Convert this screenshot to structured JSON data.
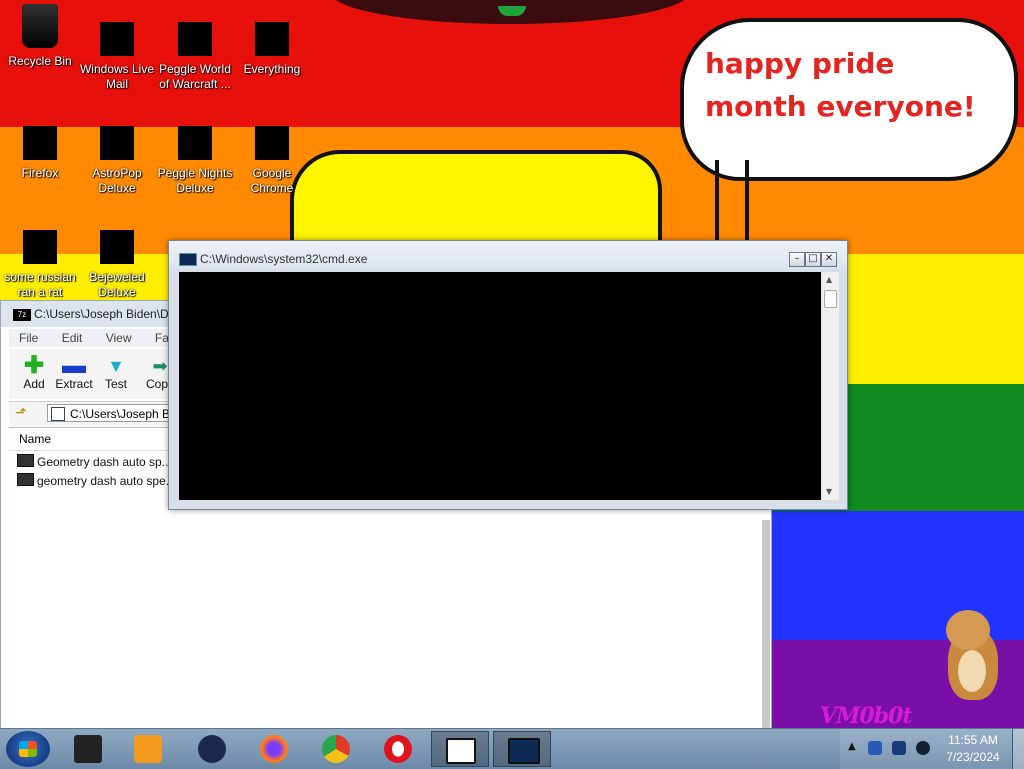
{
  "wallpaper": {
    "speech_text": "happy pride month everyone!",
    "colors": [
      "#e8100b",
      "#ff8a00",
      "#ffee00",
      "#0f8a1f",
      "#2233ff",
      "#7a0fa8"
    ]
  },
  "desktop_icons": [
    {
      "label": "Recycle Bin",
      "icon": "recycle-bin-icon"
    },
    {
      "label": "Windows Live Mail",
      "icon": "mail-icon"
    },
    {
      "label": "Peggle World of Warcraft ...",
      "icon": "peggle-wow-icon"
    },
    {
      "label": "Everything",
      "icon": "everything-search-icon"
    },
    {
      "label": "Firefox",
      "icon": "firefox-icon"
    },
    {
      "label": "AstroPop Deluxe",
      "icon": "astropop-icon"
    },
    {
      "label": "Peggle Nights Deluxe",
      "icon": "peggle-nights-icon"
    },
    {
      "label": "Google Chrome",
      "icon": "chrome-icon"
    },
    {
      "label": "some russian ran a rat",
      "icon": "file-icon"
    },
    {
      "label": "Bejeweled Deluxe",
      "icon": "bejeweled-icon"
    }
  ],
  "zip_window": {
    "title": "C:\\Users\\Joseph Biden\\Do",
    "app_icon": "7z",
    "menu": [
      "File",
      "Edit",
      "View",
      "Favorites"
    ],
    "toolbar": [
      {
        "label": "Add",
        "icon": "plus-icon",
        "color": "#23b023"
      },
      {
        "label": "Extract",
        "icon": "minus-icon",
        "color": "#1a3bc8"
      },
      {
        "label": "Test",
        "icon": "check-icon",
        "color": "#1ab0c8"
      },
      {
        "label": "Copy",
        "icon": "arrow-right-icon",
        "color": "#1a8a6a"
      }
    ],
    "address": "C:\\Users\\Joseph Bi",
    "column_name": "Name",
    "files": [
      "Geometry dash auto sp...",
      "geometry dash auto spe..."
    ]
  },
  "cmd_window": {
    "title": "C:\\Windows\\system32\\cmd.exe",
    "buttons": {
      "minimize": "–",
      "maximize": "□",
      "close": "✕"
    }
  },
  "watermark_text": "VM0b0t",
  "taskbar": {
    "pinned": [
      {
        "name": "taskbar-folder-item",
        "icon": "folder-icon",
        "color": "#222222"
      },
      {
        "name": "taskbar-media-item",
        "icon": "media-player-icon",
        "color": "#f39a1e"
      },
      {
        "name": "taskbar-browser-item",
        "icon": "globe-icon",
        "color": "#1a2a4a"
      },
      {
        "name": "taskbar-firefox-item",
        "icon": "firefox-icon",
        "color": "#ff7a1a"
      },
      {
        "name": "taskbar-chrome-item",
        "icon": "chrome-icon",
        "color": "#2aa54a"
      },
      {
        "name": "taskbar-opera-item",
        "icon": "opera-icon",
        "color": "#e0121e"
      },
      {
        "name": "taskbar-7zip-item",
        "icon": "7zip-icon",
        "color": "#111111"
      },
      {
        "name": "taskbar-cmd-item",
        "icon": "cmd-icon",
        "color": "#0c2a55"
      }
    ],
    "time": "11:55 AM",
    "date": "7/23/2024"
  }
}
